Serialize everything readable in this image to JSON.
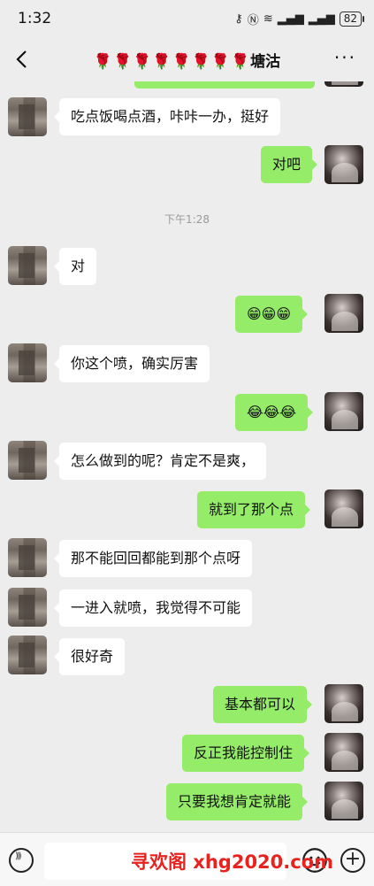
{
  "status_bar": {
    "time": "1:32",
    "battery": "82"
  },
  "header": {
    "back_icon": "chevron-left-icon",
    "roses": "🌹🌹🌹🌹🌹🌹🌹🌹",
    "title": "塘沽",
    "more": "···"
  },
  "timestamp": "下午1:28",
  "messages": [
    {
      "side": "left",
      "text": "吃点饭喝点酒，咔咔一办，挺好"
    },
    {
      "side": "right",
      "text": "对吧"
    },
    {
      "side": "left",
      "text": "对"
    },
    {
      "side": "right",
      "text": "😁😁😁"
    },
    {
      "side": "left",
      "text": "你这个喷，确实厉害"
    },
    {
      "side": "right",
      "text": "😂😂😂"
    },
    {
      "side": "left",
      "text": "怎么做到的呢？肯定不是爽，"
    },
    {
      "side": "right",
      "text": "就到了那个点"
    },
    {
      "side": "left",
      "text": "那不能回回都能到那个点呀"
    },
    {
      "side": "left",
      "text": "一进入就喷，我觉得不可能"
    },
    {
      "side": "left",
      "text": "很好奇"
    },
    {
      "side": "right",
      "text": "基本都可以"
    },
    {
      "side": "right",
      "text": "反正我能控制住"
    },
    {
      "side": "right",
      "text": "只要我想肯定就能"
    }
  ],
  "watermark": "寻欢阁 xhg2020.com",
  "bottom_bar": {
    "voice_icon": "voice-icon",
    "emoji_icon": "emoji-icon",
    "plus_icon": "plus-icon"
  }
}
